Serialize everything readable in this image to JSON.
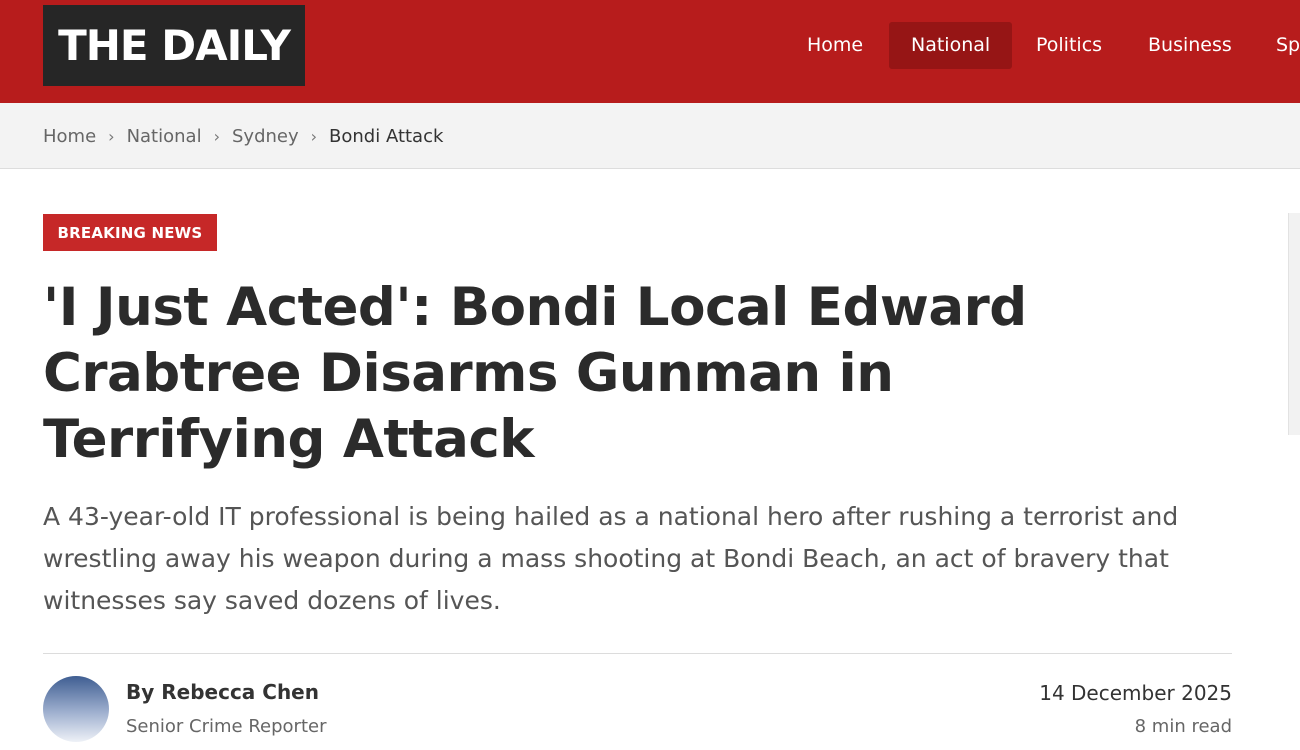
{
  "header": {
    "logo": "THE DAILY",
    "nav": [
      "Home",
      "National",
      "Politics",
      "Business",
      "Sp"
    ],
    "active_nav": "National"
  },
  "breadcrumb": [
    "Home",
    "National",
    "Sydney",
    "Bondi Attack"
  ],
  "article": {
    "badge": "BREAKING NEWS",
    "headline": "'I Just Acted': Bondi Local Edward Crabtree Disarms Gunman in Terrifying Attack",
    "dek": "A 43-year-old IT professional is being hailed as a national hero after rushing a terrorist and wrestling away his weapon during a mass shooting at Bondi Beach, an act of bravery that witnesses say saved dozens of lives.",
    "author": {
      "name": "By Rebecca Chen",
      "role": "Senior Crime Reporter"
    },
    "date": "14 December 2025",
    "read_time": "8 min read"
  },
  "colors": {
    "brand_red": "#b71c1c",
    "active_nav": "#961515",
    "badge_red": "#c62828"
  }
}
